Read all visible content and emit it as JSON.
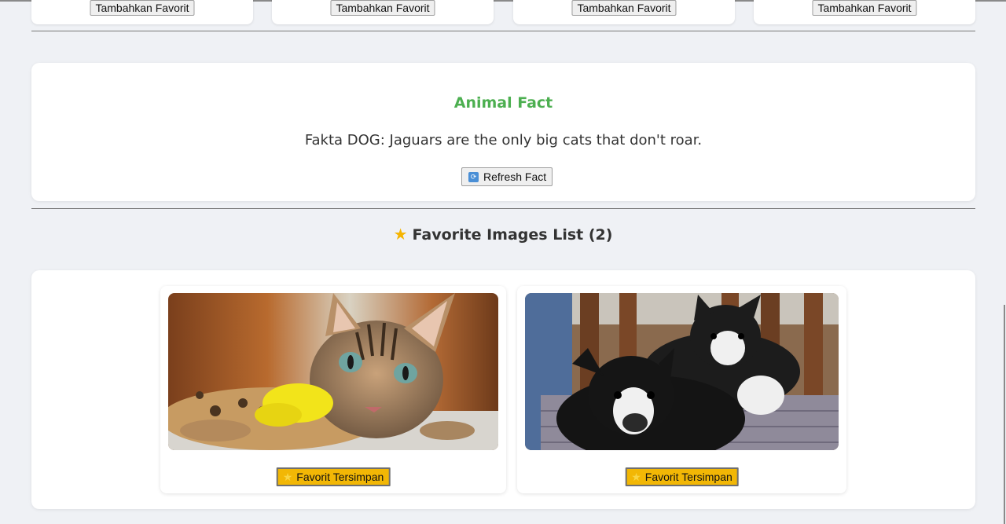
{
  "top_cards": {
    "button_label": "Tambahkan Favorit"
  },
  "fact": {
    "title": "Animal Fact",
    "text": "Fakta DOG: Jaguars are the only big cats that don't roar.",
    "refresh_label": "Refresh Fact",
    "refresh_icon": "refresh-icon",
    "title_color": "#4caf50"
  },
  "favorites": {
    "heading": "Favorite Images List (2)",
    "heading_icon": "star-icon",
    "items": [
      {
        "image": "cat-photo",
        "button_label": "Favorit Tersimpan"
      },
      {
        "image": "dogs-photo",
        "button_label": "Favorit Tersimpan"
      }
    ],
    "button_color": "#f2b705"
  }
}
